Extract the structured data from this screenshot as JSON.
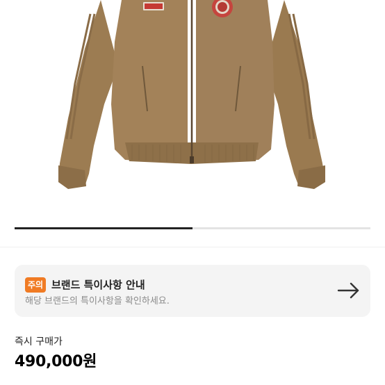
{
  "product": {
    "image_alt": "Brown corduroy track jacket",
    "image_count_progress": 0.5
  },
  "notice": {
    "badge": "주의",
    "title": "브랜드 특이사항 안내",
    "subtitle": "해당 브랜드의 특이사항을 확인하세요."
  },
  "price": {
    "label": "즉시 구매가",
    "value": "490,000원"
  },
  "colors": {
    "badge": "#f07b24",
    "jacket": "#9b7b51",
    "card_bg": "#f4f4f4"
  },
  "icons": {
    "notice_arrow": "arrow-right-icon"
  }
}
